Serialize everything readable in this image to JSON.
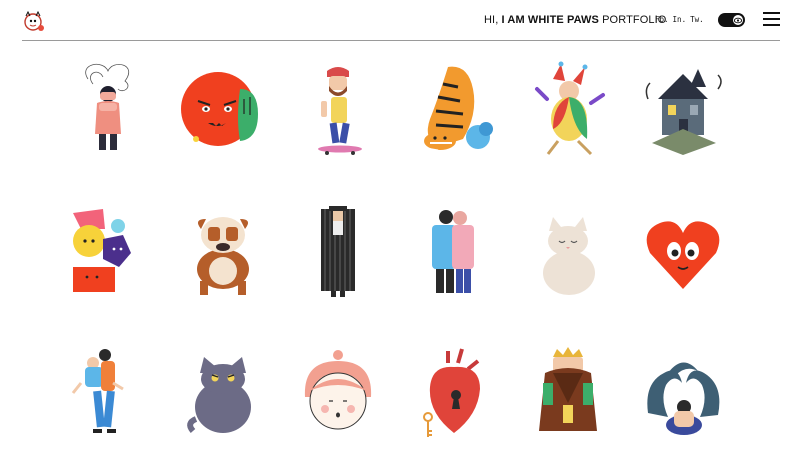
{
  "header": {
    "greeting": "HI,",
    "name_bold": "I AM WHITE PAWS",
    "suffix": "PORTFOLIO",
    "social": [
      "Fb.",
      "In.",
      "Tw."
    ]
  },
  "colors": {
    "accent_red": "#f0401f",
    "text": "#111111",
    "divider": "#9a9a9a",
    "background": "#ffffff"
  },
  "icons": {
    "logo": "paw-logo-icon",
    "theme_toggle": "eye-icon",
    "menu": "hamburger-menu-icon"
  },
  "gallery": {
    "items": [
      "anxious-girl-illustration",
      "red-face-hand-illustration",
      "skater-man-illustration",
      "tiger-illustration",
      "jester-illustration",
      "haunted-house-illustration",
      "geometric-shapes-illustration",
      "bulldog-illustration",
      "spy-trenchcoat-illustration",
      "couple-illustration",
      "white-cat-illustration",
      "heart-face-illustration",
      "piggyback-couple-illustration",
      "grumpy-cat-illustration",
      "peach-hair-girl-illustration",
      "anatomical-heart-key-illustration",
      "bearded-king-illustration",
      "sad-figure-waves-illustration"
    ]
  }
}
